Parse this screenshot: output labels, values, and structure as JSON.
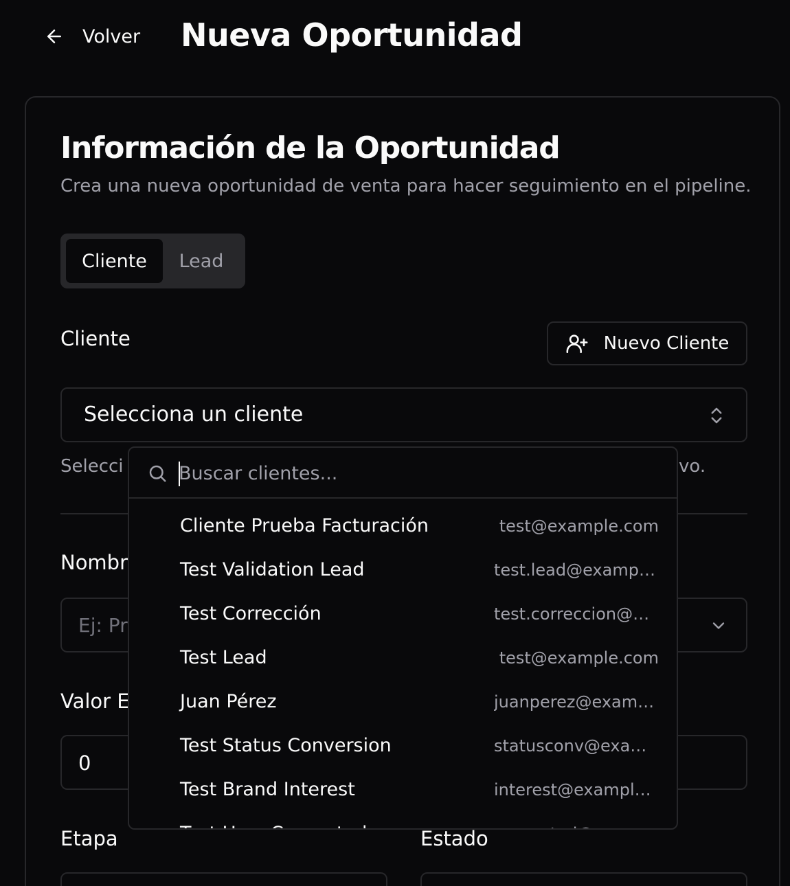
{
  "header": {
    "back_label": "Volver",
    "title": "Nueva Oportunidad"
  },
  "card": {
    "title": "Información de la Oportunidad",
    "description": "Crea una nueva oportunidad de venta para hacer seguimiento en el pipeline."
  },
  "tabs": [
    {
      "label": "Cliente",
      "active": true
    },
    {
      "label": "Lead",
      "active": false
    }
  ],
  "client_section": {
    "label": "Cliente",
    "new_button_label": "Nuevo Cliente",
    "select_placeholder": "Selecciona un cliente",
    "helper_visible_start": "Selecci",
    "helper_visible_end": "vo."
  },
  "fields": {
    "name_label_visible": "Nombr",
    "name_placeholder_visible": "Ej: Pro",
    "value_label_visible": "Valor E",
    "value_value": "0",
    "stage_label": "Etapa",
    "status_label": "Estado"
  },
  "dropdown": {
    "search_placeholder": "Buscar clientes...",
    "items": [
      {
        "name": "Cliente Prueba Facturación",
        "email": "test@example.com"
      },
      {
        "name": "Test Validation Lead",
        "email": "test.lead@example..."
      },
      {
        "name": "Test Corrección",
        "email": "test.correccion@ex..."
      },
      {
        "name": "Test Lead",
        "email": "test@example.com"
      },
      {
        "name": "Juan Pérez",
        "email": "juanperez@exampl..."
      },
      {
        "name": "Test Status Conversion",
        "email": "statusconv@examp..."
      },
      {
        "name": "Test Brand Interest",
        "email": "interest@example...."
      },
      {
        "name": "Test User Converted",
        "email": "converted@example...."
      }
    ]
  },
  "colors": {
    "background": "#09090b",
    "border": "#27272a",
    "muted_text": "#a1a1aa",
    "foreground": "#fafafa"
  }
}
